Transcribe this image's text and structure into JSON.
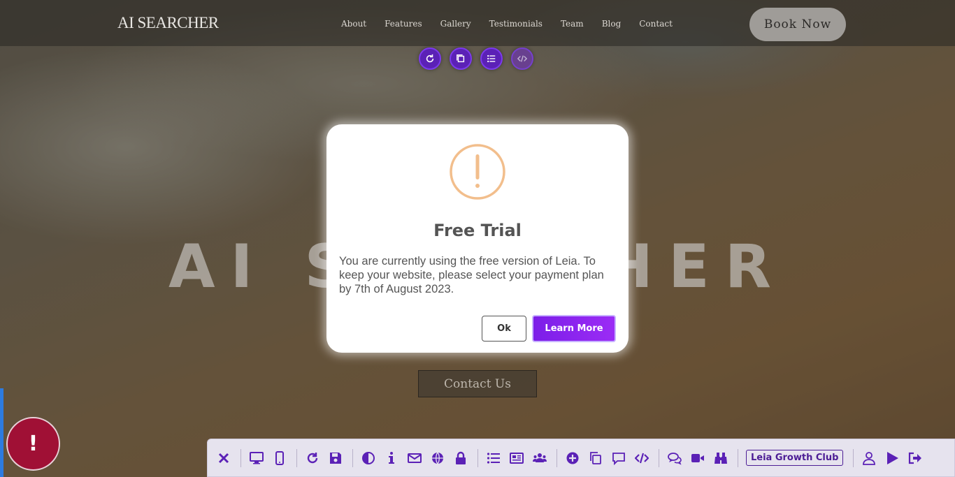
{
  "header": {
    "logo": "AI SEARCHER",
    "nav": [
      "About",
      "Features",
      "Gallery",
      "Testimonials",
      "Team",
      "Blog",
      "Contact"
    ],
    "book_label": "Book Now"
  },
  "hero": {
    "title": "AI SEARCHER",
    "contact_label": "Contact Us"
  },
  "modal": {
    "title": "Free Trial",
    "body": "You are currently using the free version of Leia. To keep your website, please select your payment plan by 7th of August 2023.",
    "ok_label": "Ok",
    "learn_label": "Learn More",
    "icon": "exclamation-circle-icon",
    "icon_color": "#f2be8c"
  },
  "alert": {
    "symbol": "!"
  },
  "toolbar": {
    "growth_label": "Leia Growth Club",
    "accent": "#5b21b6"
  },
  "mini_tools": [
    "refresh-icon",
    "copy-icon",
    "list-icon",
    "code-icon"
  ]
}
